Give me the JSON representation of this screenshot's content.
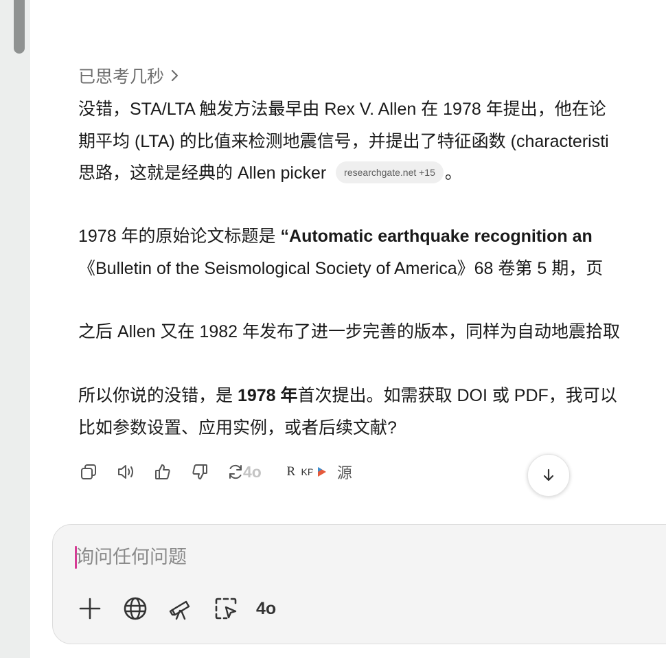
{
  "thought": {
    "label": "已思考几秒"
  },
  "answer": {
    "p1": {
      "l1": "没错，STA/LTA 触发方法最早由 Rex V. Allen 在 1978 年提出，他在论",
      "l2": "期平均 (LTA) 的比值来检测地震信号，并提出了特征函数 (characteristi",
      "l3": "思路，这就是经典的 Allen picker",
      "citation": "researchgate.net +15",
      "l3_end": "。"
    },
    "p2": {
      "l1_pre": "1978 年的原始论文标题是 ",
      "l1_bold": "“Automatic earthquake recognition an",
      "l2": "《Bulletin of the Seismological Society of America》68 卷第 5 期，页"
    },
    "p3": {
      "l1": "之后 Allen 又在 1982 年发布了进一步完善的版本，同样为自动地震拾取"
    },
    "p4": {
      "l1_pre": "所以你说的没错，是 ",
      "l1_bold": "1978 年",
      "l1_post": "首次提出。如需获取 DOI 或 PDF，我可以",
      "l2": "比如参数设置、应用实例，或者后续文献?"
    }
  },
  "actions": {
    "model": "4o",
    "sources_label": "源",
    "source_icons": [
      "R",
      "KP",
      "▲"
    ]
  },
  "composer": {
    "placeholder": "询问任何问题",
    "model": "4o"
  },
  "colors": {
    "caret": "#d63b95",
    "composer_bg": "#f4f4f4",
    "chip_bg": "#efefef"
  }
}
